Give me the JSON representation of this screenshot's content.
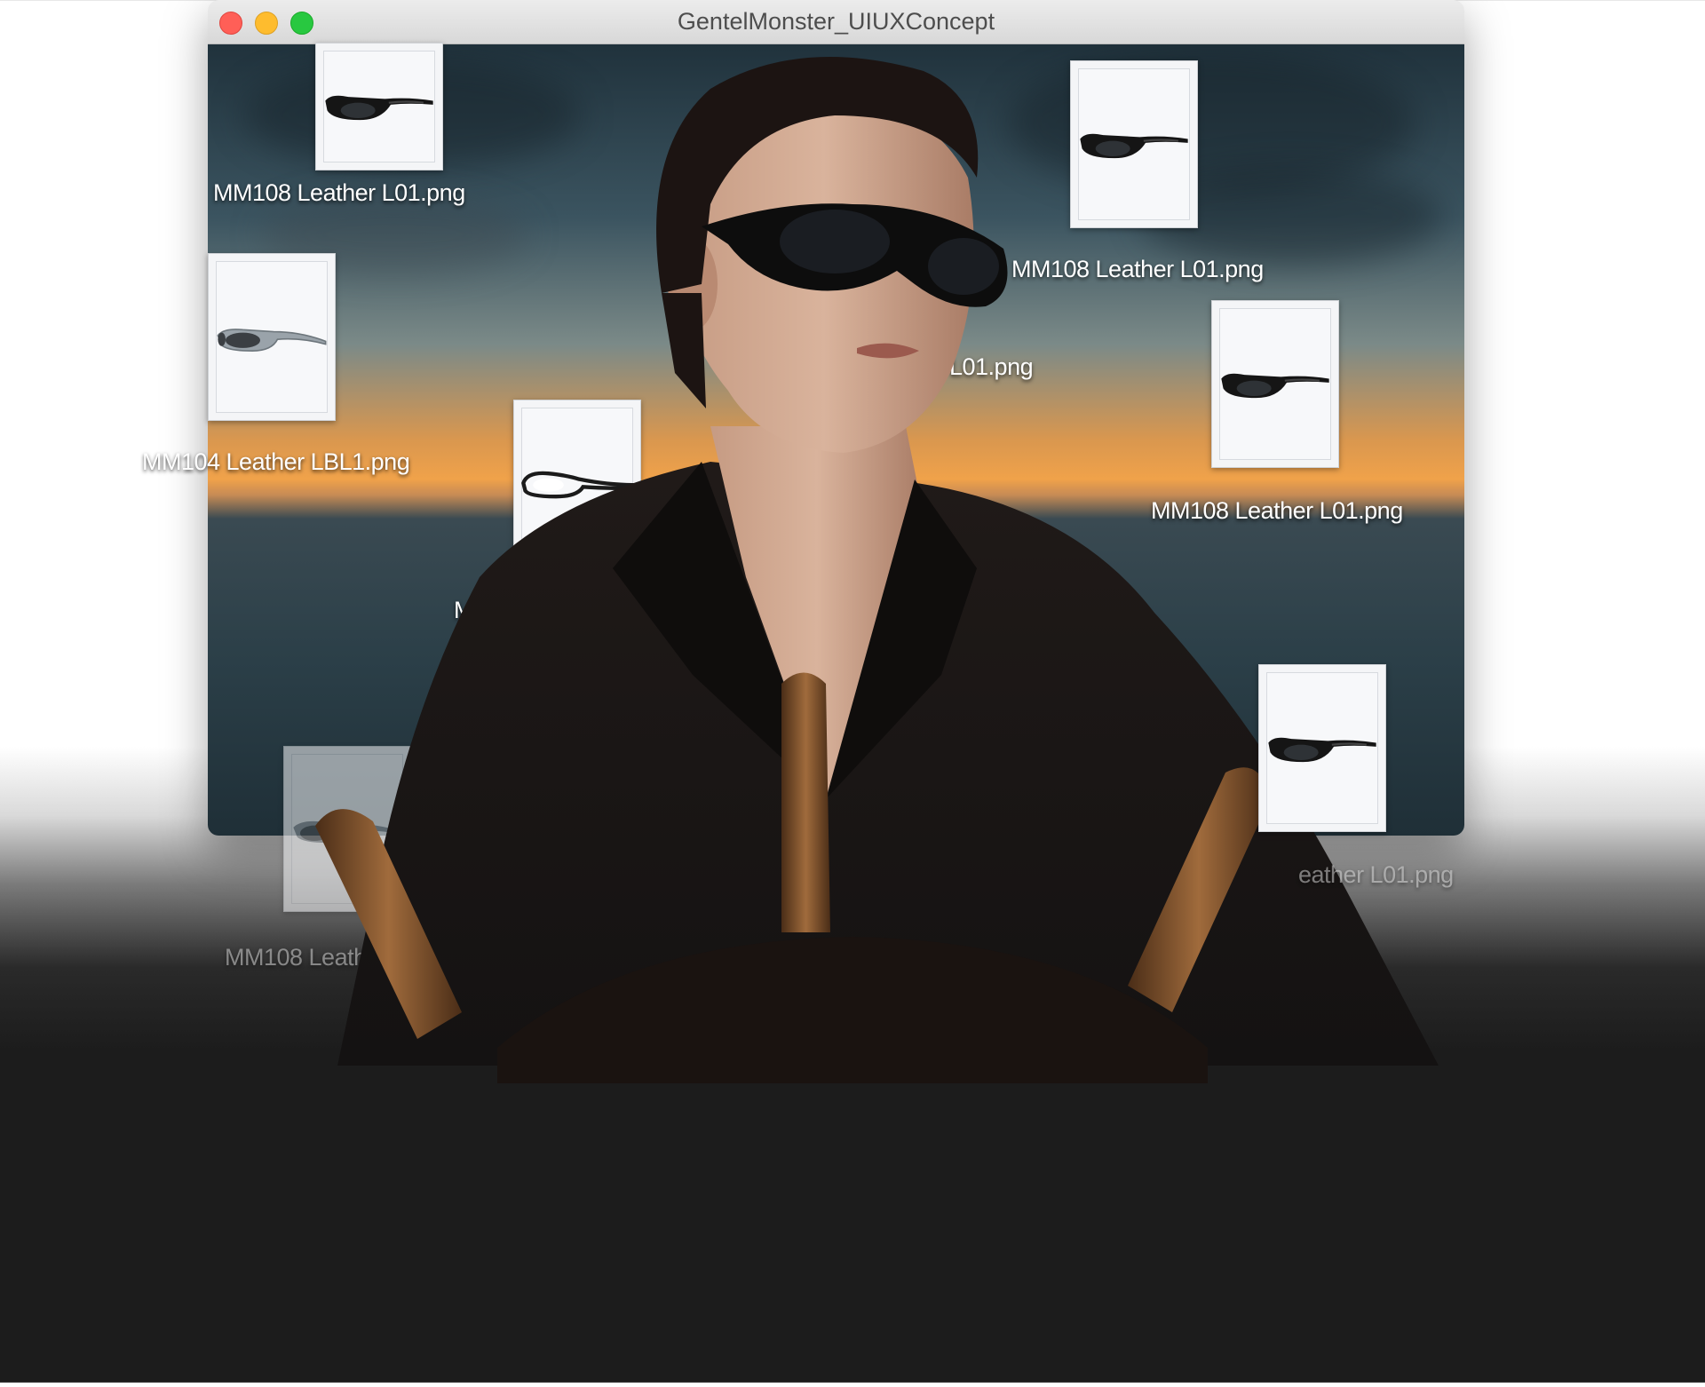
{
  "window": {
    "title": "GentelMonster_UIUXConcept",
    "controls": [
      "close",
      "minimize",
      "maximize"
    ]
  },
  "desktop_files": [
    {
      "name": "MM108 Leather L01.png",
      "icon": "black-cat-eye-sunglasses-icon"
    },
    {
      "name": "MM108 Leather L01.png",
      "icon": "black-cat-eye-sunglasses-icon"
    },
    {
      "name": "MM104 Leather LBL1.png",
      "icon": "grey-wrap-sunglasses-icon"
    },
    {
      "name": "L01.png",
      "icon": ""
    },
    {
      "name": "MM108 Leather L01.png",
      "icon": "black-cat-eye-sunglasses-icon"
    },
    {
      "name": "M",
      "icon": "clear-wrap-glasses-icon"
    },
    {
      "name": "MM108 Leather",
      "icon": "grey-sunglasses-icon"
    },
    {
      "name": "eather L01.png",
      "icon": "black-cat-eye-sunglasses-icon"
    }
  ],
  "colors": {
    "close": "#ff5f57",
    "minimize": "#febc2e",
    "maximize": "#28c840",
    "page_bottom": "#1c1c1c"
  }
}
